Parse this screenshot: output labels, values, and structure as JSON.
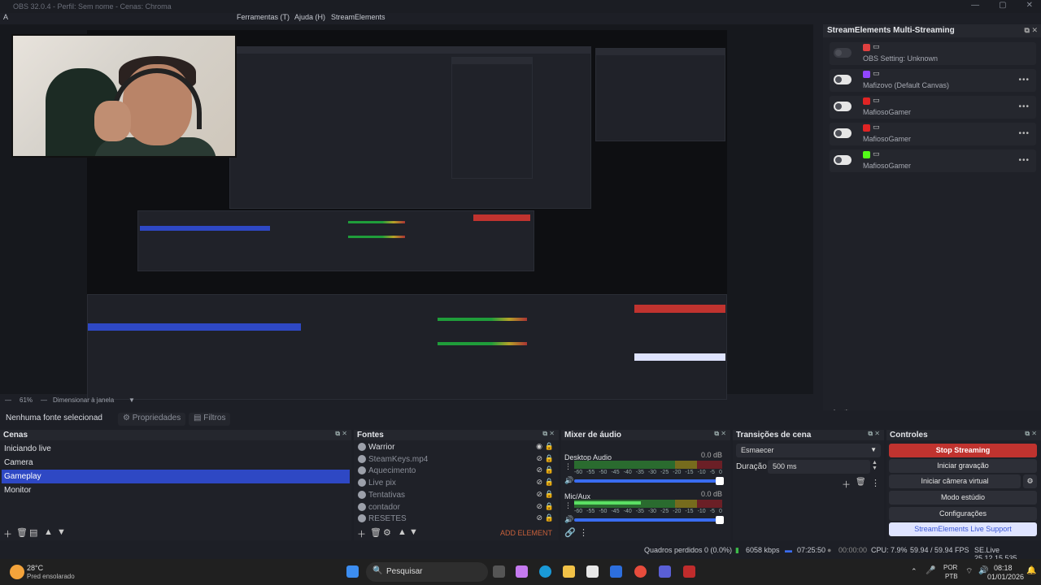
{
  "titlebar": {
    "text": "OBS 32.0.4 - Perfil: Sem nome - Cenas: Chroma"
  },
  "menu": {
    "a": "A",
    "tools": "Ferramentas (T)",
    "help": "Ajuda (H)",
    "streamelements": "StreamElements"
  },
  "preview": {
    "zoom": "61%",
    "resize_label": "Dimensionar à janela"
  },
  "multistream": {
    "title": "StreamElements Multi-Streaming",
    "items": [
      {
        "label": "OBS Setting: Unknown",
        "icon_color": "#e04040",
        "enabled": false
      },
      {
        "label": "Mafizovo (Default Canvas)",
        "icon_color": "#9146ff",
        "enabled": true
      },
      {
        "label": "MafiosoGamer",
        "icon_color": "#e02424",
        "enabled": true
      },
      {
        "label": "MafiosoGamer",
        "icon_color": "#e02424",
        "enabled": true
      },
      {
        "label": "MafiosoGamer",
        "icon_color": "#53fc18",
        "enabled": true
      }
    ]
  },
  "source_bar": {
    "label": "Nenhuma fonte selecionad",
    "properties": "Propriedades",
    "filters": "Filtros"
  },
  "scenes": {
    "title": "Cenas",
    "items": [
      "Iniciando live",
      "Camera",
      "Gameplay",
      "Monitor"
    ],
    "selected": 2
  },
  "sources": {
    "title": "Fontes",
    "items": [
      {
        "name": "Warrior",
        "visible": true
      },
      {
        "name": "SteamKeys.mp4",
        "visible": false
      },
      {
        "name": "Aquecimento",
        "visible": false
      },
      {
        "name": "Live pix",
        "visible": false
      },
      {
        "name": "Tentativas",
        "visible": false
      },
      {
        "name": "contador",
        "visible": false
      },
      {
        "name": "RESETES",
        "visible": false
      }
    ],
    "add_element": "ADD ELEMENT"
  },
  "mixer": {
    "title": "Mixer de áudio",
    "channels": [
      {
        "name": "Desktop Audio",
        "db": "0.0 dB",
        "level": 0.0
      },
      {
        "name": "Mic/Aux",
        "db": "0.0 dB",
        "level": 0.45
      }
    ],
    "scale": [
      "-60",
      "-55",
      "-50",
      "-45",
      "-40",
      "-35",
      "-30",
      "-25",
      "-20",
      "-15",
      "-10",
      "-5",
      "0"
    ]
  },
  "transitions": {
    "title": "Transições de cena",
    "selected": "Esmaecer",
    "duration_label": "Duração",
    "duration_value": "500 ms"
  },
  "controls": {
    "title": "Controles",
    "stop_streaming": "Stop Streaming",
    "start_recording": "Iniciar gravação",
    "virtual_cam": "Iniciar câmera virtual",
    "studio_mode": "Modo estúdio",
    "settings": "Configurações",
    "support": "StreamElements Live Support"
  },
  "status": {
    "dropped": "Quadros perdidos 0 (0.0%)",
    "kbps": "6058 kbps",
    "live_time": "07:25:50",
    "rec_time": "00:00:00",
    "cpu": "CPU: 7.9%",
    "fps": "59.94 / 59.94 FPS",
    "version": "SE.Live 25.12.15.535"
  },
  "taskbar": {
    "temp": "28°C",
    "weather": "Pred ensolarado",
    "search": "Pesquisar",
    "lang1": "POR",
    "lang2": "PTB",
    "time": "08:18",
    "date": "01/01/2026"
  }
}
